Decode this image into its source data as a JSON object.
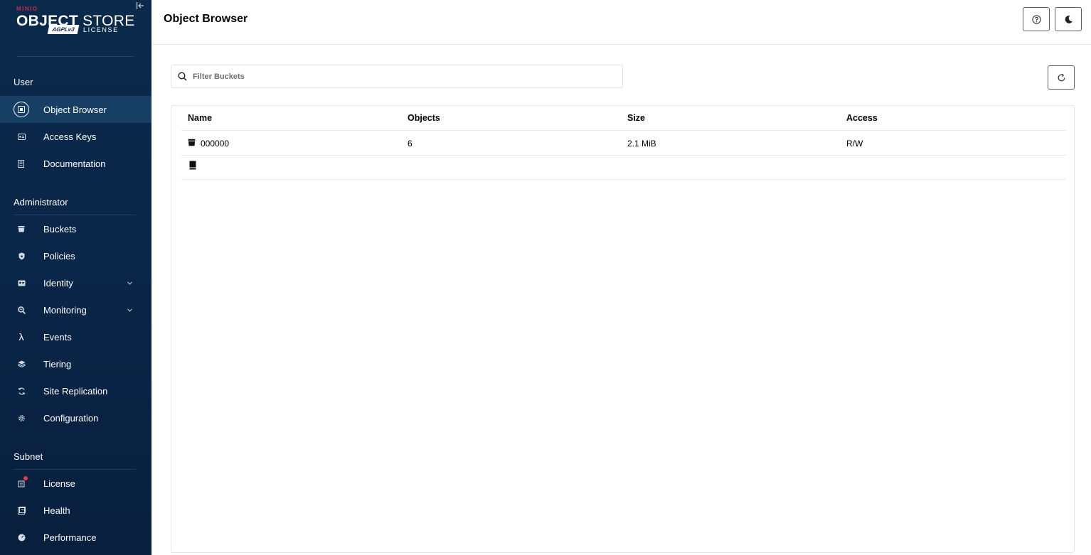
{
  "sidebar": {
    "logo": {
      "brand": "MINIO",
      "product_bold": "OBJECT",
      "product_light": " STORE",
      "license_badge": "AGPLv3",
      "license_text": "LICENSE"
    },
    "sections": [
      {
        "label": "User"
      },
      {
        "label": "Administrator"
      },
      {
        "label": "Subnet"
      }
    ],
    "user_items": [
      {
        "label": "Object Browser",
        "icon": "object-browser-icon",
        "active": true
      },
      {
        "label": "Access Keys",
        "icon": "access-keys-icon"
      },
      {
        "label": "Documentation",
        "icon": "documentation-icon"
      }
    ],
    "admin_items": [
      {
        "label": "Buckets",
        "icon": "bucket-icon"
      },
      {
        "label": "Policies",
        "icon": "shield-icon"
      },
      {
        "label": "Identity",
        "icon": "identity-icon",
        "expandable": true
      },
      {
        "label": "Monitoring",
        "icon": "monitoring-icon",
        "expandable": true
      },
      {
        "label": "Events",
        "icon": "lambda-icon"
      },
      {
        "label": "Tiering",
        "icon": "tiering-icon"
      },
      {
        "label": "Site Replication",
        "icon": "replication-icon"
      },
      {
        "label": "Configuration",
        "icon": "gear-icon"
      }
    ],
    "subnet_items": [
      {
        "label": "License",
        "icon": "license-icon",
        "badge": true
      },
      {
        "label": "Health",
        "icon": "health-icon"
      },
      {
        "label": "Performance",
        "icon": "performance-icon"
      }
    ]
  },
  "header": {
    "title": "Object Browser"
  },
  "filter": {
    "placeholder": "Filter Buckets",
    "value": ""
  },
  "table": {
    "columns": [
      "Name",
      "Objects",
      "Size",
      "Access"
    ],
    "rows": [
      {
        "name": "000000",
        "objects": "6",
        "size": "2.1 MiB",
        "access": "R/W"
      }
    ]
  },
  "colors": {
    "sidebar_bg": "#0b2a4b",
    "sidebar_active": "#173e63",
    "brand_red": "#c72c48"
  }
}
